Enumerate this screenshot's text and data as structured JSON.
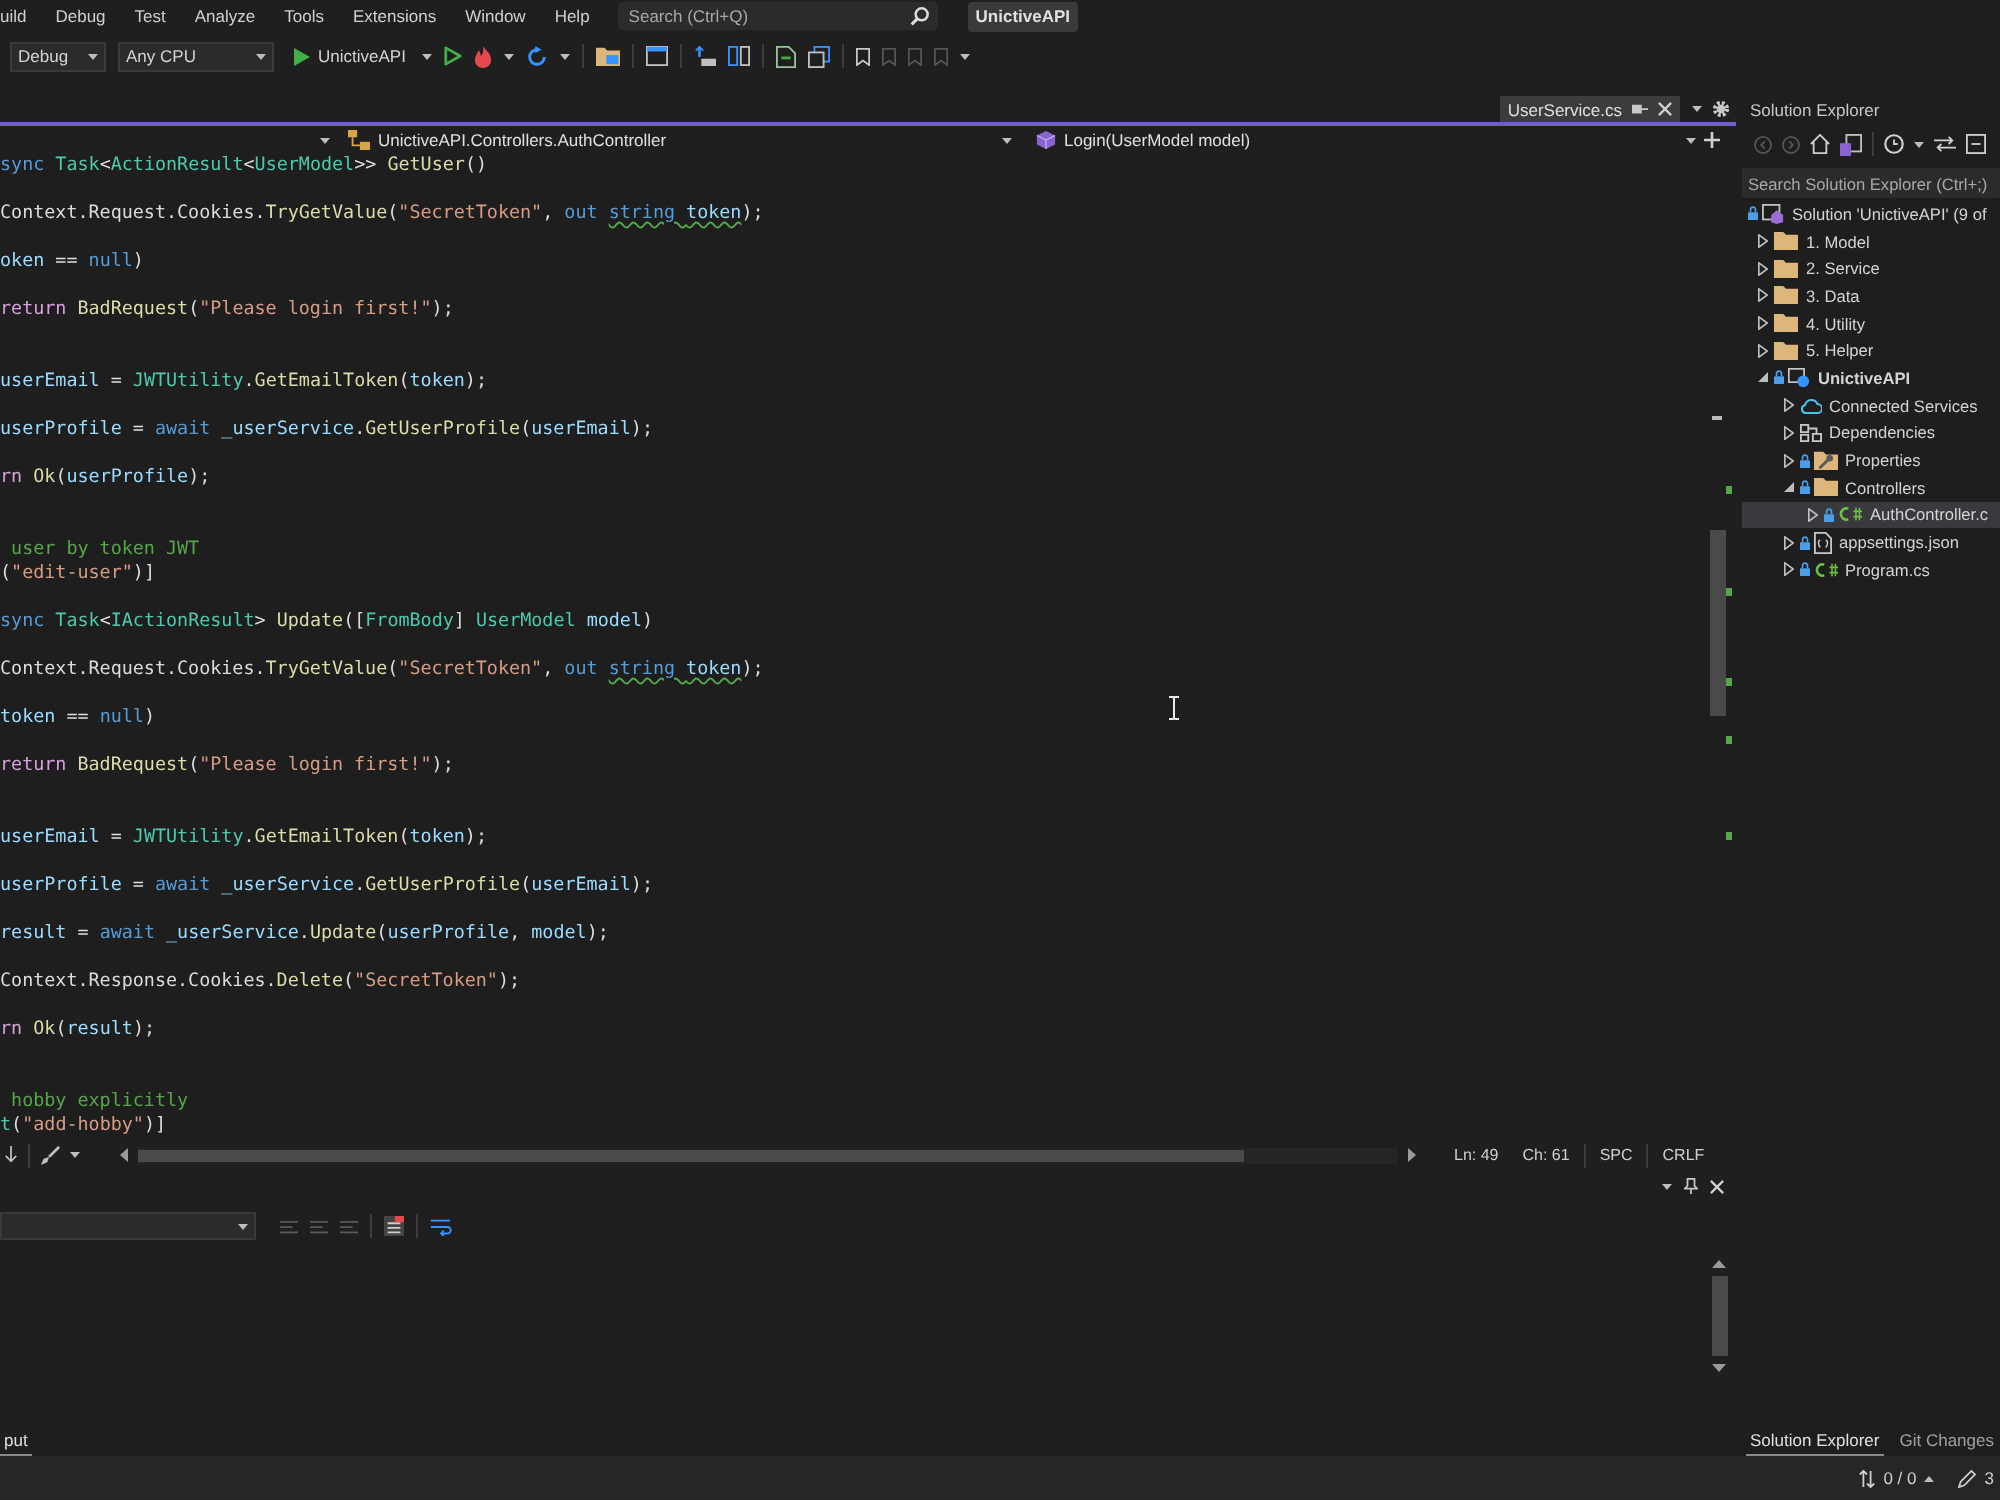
{
  "menu_bar": {
    "items": [
      "uild",
      "Debug",
      "Test",
      "Analyze",
      "Tools",
      "Extensions",
      "Window",
      "Help"
    ],
    "search": {
      "placeholder": "Search (Ctrl+Q)"
    },
    "solution_name": "UnictiveAPI"
  },
  "toolbar": {
    "configuration": "Debug",
    "platform": "Any CPU",
    "startup_project": "UnictiveAPI"
  },
  "editor": {
    "tabs": [
      {
        "label": "UserService.cs",
        "selected": false
      }
    ],
    "navigation": {
      "type_scope": "UnictiveAPI.Controllers.AuthController",
      "member": "Login(UserModel model)"
    },
    "lines": [
      {
        "kind": "code",
        "tokens": [
          {
            "text": "sync ",
            "kind": "keyword"
          },
          {
            "text": "Task",
            "kind": "type"
          },
          {
            "text": "<",
            "kind": "plain"
          },
          {
            "text": "ActionResult",
            "kind": "type"
          },
          {
            "text": "<",
            "kind": "plain"
          },
          {
            "text": "UserModel",
            "kind": "type"
          },
          {
            "text": ">> ",
            "kind": "plain"
          },
          {
            "text": "GetUser",
            "kind": "method"
          },
          {
            "text": "()",
            "kind": "plain"
          }
        ]
      },
      {
        "kind": "blank"
      },
      {
        "kind": "code",
        "tokens": [
          {
            "text": "Context.Request.Cookies.",
            "kind": "plain"
          },
          {
            "text": "TryGetValue",
            "kind": "method"
          },
          {
            "text": "(",
            "kind": "plain"
          },
          {
            "text": "\"SecretToken\"",
            "kind": "string"
          },
          {
            "text": ", ",
            "kind": "plain"
          },
          {
            "text": "out ",
            "kind": "keyword"
          },
          {
            "kind": "squiggle",
            "tokens": [
              {
                "text": "string ",
                "kind": "keyword"
              },
              {
                "text": "token",
                "kind": "variable"
              }
            ]
          },
          {
            "text": ");",
            "kind": "plain"
          }
        ]
      },
      {
        "kind": "blank"
      },
      {
        "kind": "code",
        "tokens": [
          {
            "text": "oken",
            "kind": "variable"
          },
          {
            "text": " == ",
            "kind": "plain"
          },
          {
            "text": "null",
            "kind": "keyword"
          },
          {
            "text": ")",
            "kind": "plain"
          }
        ]
      },
      {
        "kind": "blank"
      },
      {
        "kind": "code",
        "tokens": [
          {
            "text": "return ",
            "kind": "control"
          },
          {
            "text": "BadRequest",
            "kind": "method"
          },
          {
            "text": "(",
            "kind": "plain"
          },
          {
            "text": "\"Please login first!\"",
            "kind": "string"
          },
          {
            "text": ");",
            "kind": "plain"
          }
        ]
      },
      {
        "kind": "blank"
      },
      {
        "kind": "blank"
      },
      {
        "kind": "code",
        "tokens": [
          {
            "text": "userEmail",
            "kind": "variable"
          },
          {
            "text": " = ",
            "kind": "plain"
          },
          {
            "text": "JWTUtility",
            "kind": "type"
          },
          {
            "text": ".",
            "kind": "plain"
          },
          {
            "text": "GetEmailToken",
            "kind": "method"
          },
          {
            "text": "(",
            "kind": "plain"
          },
          {
            "text": "token",
            "kind": "variable"
          },
          {
            "text": ");",
            "kind": "plain"
          }
        ]
      },
      {
        "kind": "blank"
      },
      {
        "kind": "code",
        "tokens": [
          {
            "text": "userProfile",
            "kind": "variable"
          },
          {
            "text": " = ",
            "kind": "plain"
          },
          {
            "text": "await ",
            "kind": "keyword"
          },
          {
            "text": "_userService",
            "kind": "variable"
          },
          {
            "text": ".",
            "kind": "plain"
          },
          {
            "text": "GetUserProfile",
            "kind": "method"
          },
          {
            "text": "(",
            "kind": "plain"
          },
          {
            "text": "userEmail",
            "kind": "variable"
          },
          {
            "text": ");",
            "kind": "plain"
          }
        ]
      },
      {
        "kind": "blank"
      },
      {
        "kind": "code",
        "tokens": [
          {
            "text": "rn ",
            "kind": "control"
          },
          {
            "text": "Ok",
            "kind": "method"
          },
          {
            "text": "(",
            "kind": "plain"
          },
          {
            "text": "userProfile",
            "kind": "variable"
          },
          {
            "text": ");",
            "kind": "plain"
          }
        ]
      },
      {
        "kind": "blank"
      },
      {
        "kind": "blank"
      },
      {
        "kind": "code",
        "tokens": [
          {
            "text": " user by token JWT",
            "kind": "comment"
          }
        ]
      },
      {
        "kind": "code",
        "tokens": [
          {
            "text": "(",
            "kind": "plain"
          },
          {
            "text": "\"edit-user\"",
            "kind": "string"
          },
          {
            "text": ")]",
            "kind": "plain"
          }
        ]
      },
      {
        "kind": "blank"
      },
      {
        "kind": "code",
        "tokens": [
          {
            "text": "sync ",
            "kind": "keyword"
          },
          {
            "text": "Task",
            "kind": "type"
          },
          {
            "text": "<",
            "kind": "plain"
          },
          {
            "text": "IActionResult",
            "kind": "type"
          },
          {
            "text": "> ",
            "kind": "plain"
          },
          {
            "text": "Update",
            "kind": "method"
          },
          {
            "text": "([",
            "kind": "plain"
          },
          {
            "text": "FromBody",
            "kind": "type"
          },
          {
            "text": "] ",
            "kind": "plain"
          },
          {
            "text": "UserModel ",
            "kind": "type"
          },
          {
            "text": "model",
            "kind": "variable"
          },
          {
            "text": ")",
            "kind": "plain"
          }
        ]
      },
      {
        "kind": "blank"
      },
      {
        "kind": "code",
        "tokens": [
          {
            "text": "Context.Request.Cookies.",
            "kind": "plain"
          },
          {
            "text": "TryGetValue",
            "kind": "method"
          },
          {
            "text": "(",
            "kind": "plain"
          },
          {
            "text": "\"SecretToken\"",
            "kind": "string"
          },
          {
            "text": ", ",
            "kind": "plain"
          },
          {
            "text": "out ",
            "kind": "keyword"
          },
          {
            "kind": "squiggle",
            "tokens": [
              {
                "text": "string ",
                "kind": "keyword"
              },
              {
                "text": "token",
                "kind": "variable"
              }
            ]
          },
          {
            "text": ");",
            "kind": "plain"
          }
        ]
      },
      {
        "kind": "blank"
      },
      {
        "kind": "code",
        "tokens": [
          {
            "text": "token",
            "kind": "variable"
          },
          {
            "text": " == ",
            "kind": "plain"
          },
          {
            "text": "null",
            "kind": "keyword"
          },
          {
            "text": ")",
            "kind": "plain"
          }
        ]
      },
      {
        "kind": "blank"
      },
      {
        "kind": "code",
        "tokens": [
          {
            "text": "return ",
            "kind": "control"
          },
          {
            "text": "BadRequest",
            "kind": "method"
          },
          {
            "text": "(",
            "kind": "plain"
          },
          {
            "text": "\"Please login first!\"",
            "kind": "string"
          },
          {
            "text": ");",
            "kind": "plain"
          }
        ]
      },
      {
        "kind": "blank"
      },
      {
        "kind": "blank"
      },
      {
        "kind": "code",
        "tokens": [
          {
            "text": "userEmail",
            "kind": "variable"
          },
          {
            "text": " = ",
            "kind": "plain"
          },
          {
            "text": "JWTUtility",
            "kind": "type"
          },
          {
            "text": ".",
            "kind": "plain"
          },
          {
            "text": "GetEmailToken",
            "kind": "method"
          },
          {
            "text": "(",
            "kind": "plain"
          },
          {
            "text": "token",
            "kind": "variable"
          },
          {
            "text": ");",
            "kind": "plain"
          }
        ]
      },
      {
        "kind": "blank"
      },
      {
        "kind": "code",
        "tokens": [
          {
            "text": "userProfile",
            "kind": "variable"
          },
          {
            "text": " = ",
            "kind": "plain"
          },
          {
            "text": "await ",
            "kind": "keyword"
          },
          {
            "text": "_userService",
            "kind": "variable"
          },
          {
            "text": ".",
            "kind": "plain"
          },
          {
            "text": "GetUserProfile",
            "kind": "method"
          },
          {
            "text": "(",
            "kind": "plain"
          },
          {
            "text": "userEmail",
            "kind": "variable"
          },
          {
            "text": ");",
            "kind": "plain"
          }
        ]
      },
      {
        "kind": "blank"
      },
      {
        "kind": "code",
        "tokens": [
          {
            "text": "result",
            "kind": "variable"
          },
          {
            "text": " = ",
            "kind": "plain"
          },
          {
            "text": "await ",
            "kind": "keyword"
          },
          {
            "text": "_userService",
            "kind": "variable"
          },
          {
            "text": ".",
            "kind": "plain"
          },
          {
            "text": "Update",
            "kind": "method"
          },
          {
            "text": "(",
            "kind": "plain"
          },
          {
            "text": "userProfile",
            "kind": "variable"
          },
          {
            "text": ", ",
            "kind": "plain"
          },
          {
            "text": "model",
            "kind": "variable"
          },
          {
            "text": ");",
            "kind": "plain"
          }
        ]
      },
      {
        "kind": "blank"
      },
      {
        "kind": "code",
        "tokens": [
          {
            "text": "Context.Response.Cookies.",
            "kind": "plain"
          },
          {
            "text": "Delete",
            "kind": "method"
          },
          {
            "text": "(",
            "kind": "plain"
          },
          {
            "text": "\"SecretToken\"",
            "kind": "string"
          },
          {
            "text": ");",
            "kind": "plain"
          }
        ]
      },
      {
        "kind": "blank"
      },
      {
        "kind": "code",
        "tokens": [
          {
            "text": "rn ",
            "kind": "control"
          },
          {
            "text": "Ok",
            "kind": "method"
          },
          {
            "text": "(",
            "kind": "plain"
          },
          {
            "text": "result",
            "kind": "variable"
          },
          {
            "text": ");",
            "kind": "plain"
          }
        ]
      },
      {
        "kind": "blank"
      },
      {
        "kind": "blank"
      },
      {
        "kind": "code",
        "tokens": [
          {
            "text": " hobby explicitly",
            "kind": "comment"
          }
        ]
      },
      {
        "kind": "code",
        "tokens": [
          {
            "text": "t",
            "kind": "type"
          },
          {
            "text": "(",
            "kind": "plain"
          },
          {
            "text": "\"add-hobby\"",
            "kind": "string"
          },
          {
            "text": ")]",
            "kind": "plain"
          }
        ]
      }
    ],
    "status": {
      "line": "Ln: 49",
      "column": "Ch: 61",
      "indentation": "SPC",
      "line_endings": "CRLF"
    }
  },
  "output_panel": {
    "tabs": [
      {
        "label": "put",
        "selected": true
      }
    ]
  },
  "solution_explorer": {
    "title": "Solution Explorer",
    "search": {
      "placeholder": "Search Solution Explorer (Ctrl+;)"
    },
    "solution": {
      "label": "Solution 'UnictiveAPI' (9 of",
      "kind": "solution",
      "locked": true,
      "selected": false,
      "children": [
        {
          "label": "1. Model",
          "kind": "folder",
          "locked": false,
          "expanded": false,
          "selected": false
        },
        {
          "label": "2. Service",
          "kind": "folder",
          "locked": false,
          "expanded": false,
          "selected": false
        },
        {
          "label": "3. Data",
          "kind": "folder",
          "locked": false,
          "expanded": false,
          "selected": false
        },
        {
          "label": "4. Utility",
          "kind": "folder",
          "locked": false,
          "expanded": false,
          "selected": false
        },
        {
          "label": "5. Helper",
          "kind": "folder",
          "locked": false,
          "expanded": false,
          "selected": false
        },
        {
          "label": "UnictiveAPI",
          "kind": "project",
          "locked": true,
          "expanded": true,
          "selected": false,
          "children": [
            {
              "label": "Connected Services",
              "kind": "connected_services",
              "locked": false,
              "expanded": false,
              "selected": false
            },
            {
              "label": "Dependencies",
              "kind": "dependencies",
              "locked": false,
              "expanded": false,
              "selected": false
            },
            {
              "label": "Properties",
              "kind": "properties",
              "locked": true,
              "expanded": false,
              "selected": false
            },
            {
              "label": "Controllers",
              "kind": "folder",
              "locked": true,
              "expanded": true,
              "selected": false,
              "children": [
                {
                  "label": "AuthController.c",
                  "kind": "csharp",
                  "locked": true,
                  "expanded": false,
                  "selected": true
                }
              ]
            },
            {
              "label": "appsettings.json",
              "kind": "json",
              "locked": true,
              "expanded": false,
              "selected": false
            },
            {
              "label": "Program.cs",
              "kind": "csharp",
              "locked": true,
              "expanded": false,
              "selected": false
            }
          ]
        }
      ]
    },
    "tabs": [
      {
        "label": "Solution Explorer",
        "selected": true
      },
      {
        "label": "Git Changes",
        "selected": false
      }
    ]
  },
  "status_bar": {
    "pending_changes": "0 / 0",
    "edits": "3"
  }
}
